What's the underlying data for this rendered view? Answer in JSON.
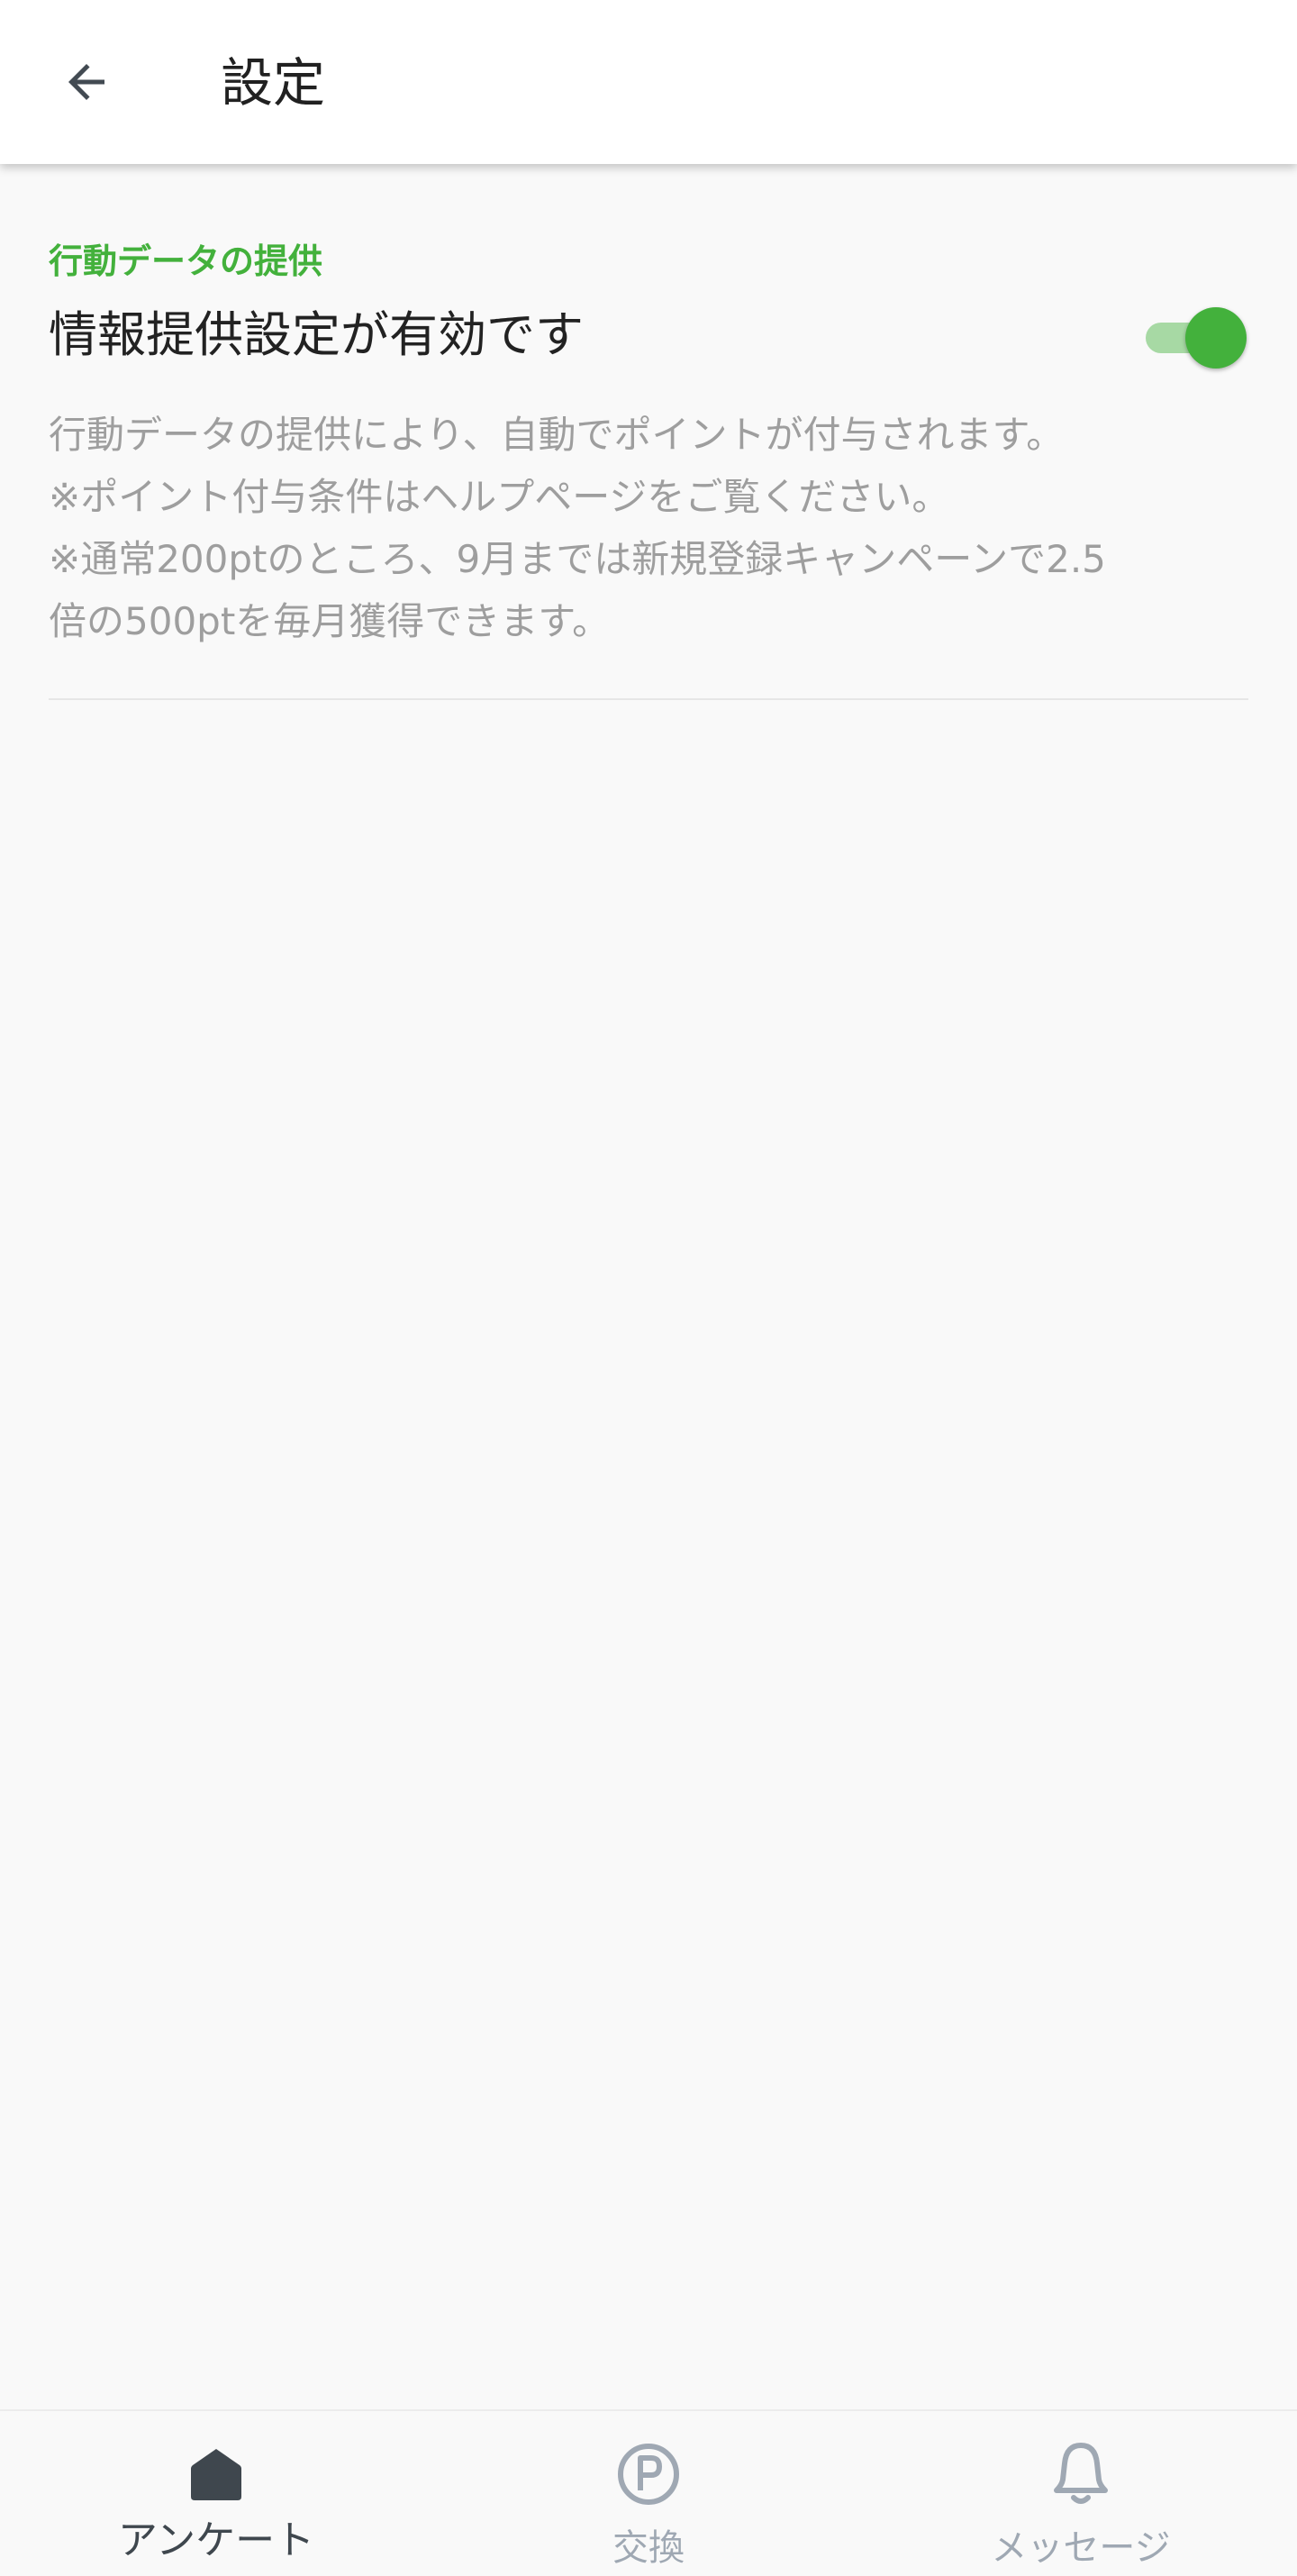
{
  "header": {
    "title": "設定"
  },
  "section": {
    "header": "行動データの提供",
    "setting_title": "情報提供設定が有効です",
    "toggle_on": true,
    "description": [
      "行動データの提供により、自動でポイントが付与されます。",
      "※ポイント付与条件はヘルプページをご覧ください。",
      "※通常200ptのところ、9月までは新規登録キャンペーンで2.5",
      "倍の500ptを毎月獲得できます。"
    ]
  },
  "bottom_nav": {
    "items": [
      {
        "label": "アンケート",
        "icon": "home-icon",
        "active": true
      },
      {
        "label": "交換",
        "icon": "points-icon",
        "active": false
      },
      {
        "label": "メッセージ",
        "icon": "bell-icon",
        "active": false
      }
    ]
  },
  "colors": {
    "accent": "#43b13c",
    "active_nav": "#3f474e",
    "inactive_nav": "#9fa8b3"
  }
}
